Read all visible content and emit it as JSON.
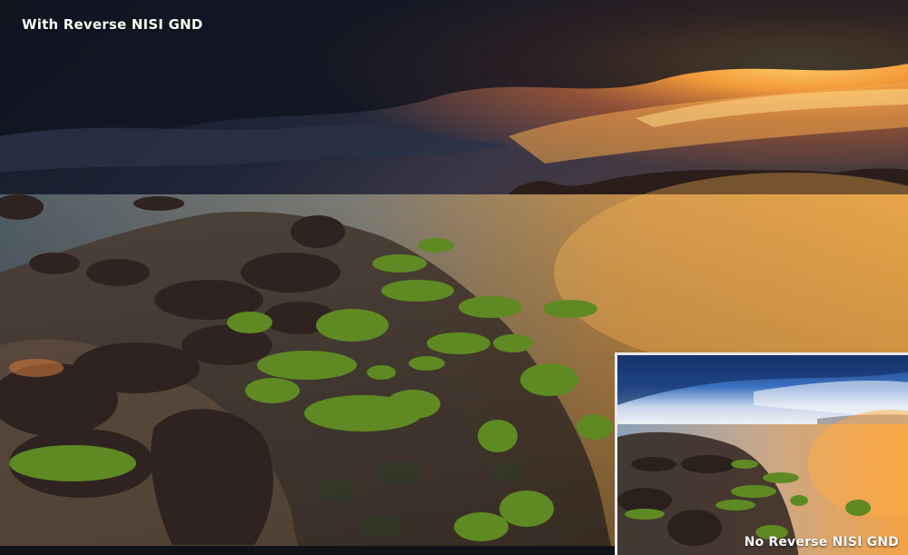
{
  "captions": {
    "main": "With Reverse NISI GND",
    "inset": "No Reverse NISI GND"
  },
  "colors": {
    "sky_dark": "#1c2233",
    "sunset_orange": "#f08a2c",
    "water_glow": "#f3a545",
    "moss_green": "#6f9a2a",
    "rock_brown": "#3a2b24",
    "inset_sky_blue": "#2a63b8"
  }
}
